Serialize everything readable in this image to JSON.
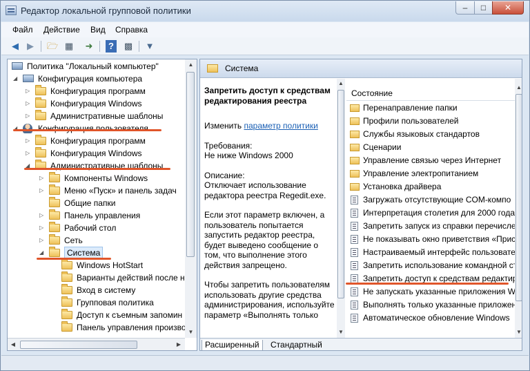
{
  "window": {
    "title": "Редактор локальной групповой политики"
  },
  "menu": [
    "Файл",
    "Действие",
    "Вид",
    "Справка"
  ],
  "tree": {
    "root": "Политика \"Локальный компьютер\"",
    "items": [
      {
        "label": "Конфигурация компьютера"
      },
      {
        "label": "Конфигурация программ"
      },
      {
        "label": "Конфигурация Windows"
      },
      {
        "label": "Административные шаблоны"
      },
      {
        "label": "Конфигурация пользователя"
      },
      {
        "label": "Конфигурация программ"
      },
      {
        "label": "Конфигурация Windows"
      },
      {
        "label": "Административные шаблоны"
      },
      {
        "label": "Компоненты Windows"
      },
      {
        "label": "Меню «Пуск» и панель задач"
      },
      {
        "label": "Общие папки"
      },
      {
        "label": "Панель управления"
      },
      {
        "label": "Рабочий стол"
      },
      {
        "label": "Сеть"
      },
      {
        "label": "Система"
      },
      {
        "label": "Windows HotStart"
      },
      {
        "label": "Варианты действий после на"
      },
      {
        "label": "Вход в систему"
      },
      {
        "label": "Групповая политика"
      },
      {
        "label": "Доступ к съемным запомин"
      },
      {
        "label": "Панель управления произво"
      }
    ]
  },
  "details": {
    "header": "Система",
    "title": "Запретить доступ к средствам редактирования реестра",
    "edit_prefix": "Изменить",
    "edit_link": "параметр политики",
    "requirements_label": "Требования:",
    "requirements_value": "Не ниже Windows 2000",
    "description_label": "Описание:",
    "description_1": "Отключает использование редактора реестра Regedit.exe.",
    "description_2": "Если этот параметр включен, а пользователь попытается запустить редактор реестра, будет выведено сообщение о том, что выполнение этого действия запрещено.",
    "description_3": "Чтобы запретить пользователям использовать другие средства администрирования, используйте параметр «Выполнять только"
  },
  "list": {
    "column": "Состояние",
    "rows": [
      {
        "label": "Перенаправление папки",
        "icon": "folder"
      },
      {
        "label": "Профили пользователей",
        "icon": "folder"
      },
      {
        "label": "Службы языковых стандартов",
        "icon": "folder"
      },
      {
        "label": "Сценарии",
        "icon": "folder"
      },
      {
        "label": "Управление связью через Интернет",
        "icon": "folder"
      },
      {
        "label": "Управление электропитанием",
        "icon": "folder"
      },
      {
        "label": "Установка драйвера",
        "icon": "folder"
      },
      {
        "label": "Загружать отсутствующие COM-компо",
        "icon": "setting"
      },
      {
        "label": "Интерпретация столетия для 2000 года",
        "icon": "setting"
      },
      {
        "label": "Запретить запуск из справки перечисле",
        "icon": "setting"
      },
      {
        "label": "Не показывать окно приветствия «Прис",
        "icon": "setting"
      },
      {
        "label": "Настраиваемый интерфейс пользовате",
        "icon": "setting"
      },
      {
        "label": "Запретить использование командной ст",
        "icon": "setting"
      },
      {
        "label": "Запретить доступ к средствам редактир",
        "icon": "setting"
      },
      {
        "label": "Не запускать указанные приложения W",
        "icon": "setting"
      },
      {
        "label": "Выполнять только указанные приложен",
        "icon": "setting"
      },
      {
        "label": "Автоматическое обновление Windows",
        "icon": "setting"
      }
    ]
  },
  "tabs": [
    "Расширенный",
    "Стандартный"
  ],
  "colors": {
    "annotation": "#e0552a",
    "link": "#1a5fb4"
  }
}
